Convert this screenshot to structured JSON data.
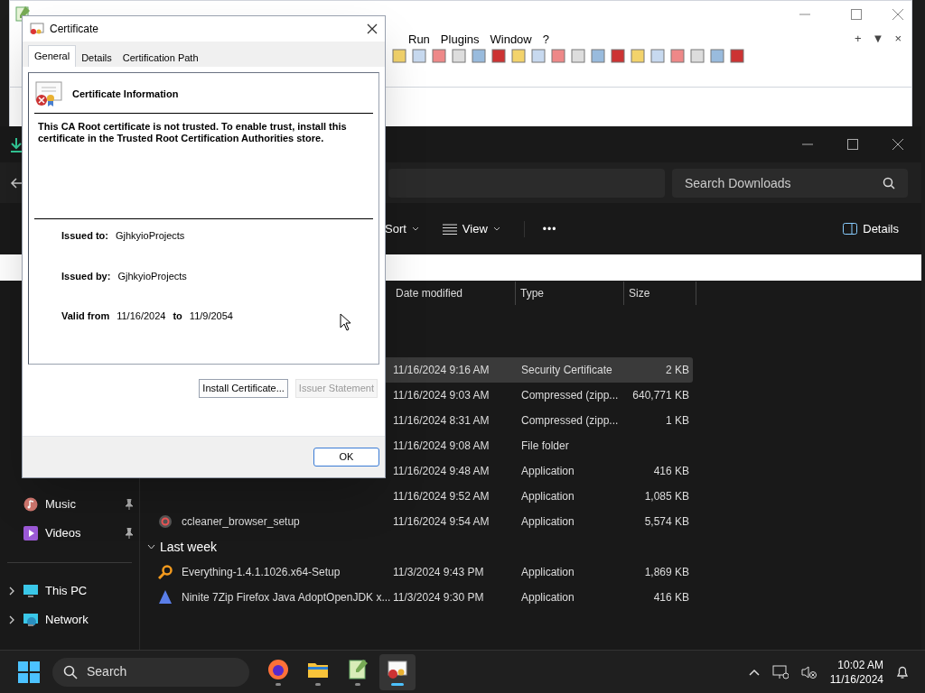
{
  "notepad": {
    "menu": [
      "Run",
      "Plugins",
      "Window",
      "?"
    ],
    "tab_controls": [
      "+",
      "▼",
      "×"
    ]
  },
  "explorer": {
    "search": {
      "placeholder": "Search Downloads"
    },
    "toolbar": [
      {
        "kind": "sort",
        "label": "Sort"
      },
      {
        "kind": "view",
        "label": "View"
      },
      {
        "kind": "more",
        "label": "•••"
      },
      {
        "kind": "details",
        "label": "Details"
      }
    ],
    "columns": [
      "Date modified",
      "Type",
      "Size"
    ],
    "groups": [
      {
        "rows": [
          {
            "date": "11/16/2024 9:16 AM",
            "type": "Security Certificate",
            "size": "2 KB",
            "selected": true
          },
          {
            "date": "11/16/2024 9:03 AM",
            "type": "Compressed (zipp...",
            "size": "640,771 KB",
            "selected": false
          },
          {
            "date": "11/16/2024 8:31 AM",
            "type": "Compressed (zipp...",
            "size": "1 KB",
            "selected": false
          },
          {
            "date": "11/16/2024 9:08 AM",
            "type": "File folder",
            "selected": false
          },
          {
            "date": "11/16/2024 9:48 AM",
            "type": "Application",
            "size": "416 KB",
            "selected": false
          },
          {
            "date": "11/16/2024 9:52 AM",
            "type": "Application",
            "size": "1,085 KB",
            "selected": false
          },
          {
            "name": "ccleaner_browser_setup",
            "kind": "ccleaner",
            "date": "11/16/2024 9:54 AM",
            "type": "Application",
            "size": "5,574 KB",
            "selected": false
          }
        ]
      },
      {
        "title": "Last week",
        "rows": [
          {
            "name": "Everything-1.4.1.1026.x64-Setup",
            "kind": "everything",
            "date": "11/3/2024 9:43 PM",
            "type": "Application",
            "size": "1,869 KB",
            "selected": false
          },
          {
            "name": "Ninite 7Zip Firefox Java AdoptOpenJDK x...",
            "kind": "ninite",
            "date": "11/3/2024 9:30 PM",
            "type": "Application",
            "size": "416 KB",
            "selected": false
          }
        ]
      }
    ],
    "sidebar": [
      {
        "kind": "music",
        "label": "Music",
        "pinned": true
      },
      {
        "kind": "videos",
        "label": "Videos",
        "pinned": true
      },
      {
        "kind": "divider"
      },
      {
        "kind": "pc",
        "label": "This PC",
        "expandable": true
      },
      {
        "kind": "network",
        "label": "Network",
        "expandable": true
      }
    ]
  },
  "dialog": {
    "title": "Certificate",
    "tabs": [
      {
        "label": "General",
        "selected": true
      },
      {
        "label": "Details",
        "selected": false
      },
      {
        "label": "Certification Path",
        "selected": false
      }
    ],
    "heading": "Certificate Information",
    "message": "This CA Root certificate is not trusted. To enable trust, install this certificate in the Trusted Root Certification Authorities store.",
    "issued_to_label": "Issued to:",
    "issued_to": "GjhkyioProjects",
    "issued_by_label": "Issued by:",
    "issued_by": "GjhkyioProjects",
    "valid_from_label": "Valid from",
    "valid_from": "11/16/2024",
    "valid_to_label": "to",
    "valid_to": "11/9/2054",
    "buttons": [
      {
        "label": "Install Certificate...",
        "disabled": false
      },
      {
        "label": "Issuer Statement",
        "disabled": true
      }
    ],
    "ok": "OK"
  },
  "taskbar": {
    "search": "Search",
    "apps": [
      {
        "kind": "firefox",
        "active": false
      },
      {
        "kind": "folder",
        "active": false
      },
      {
        "kind": "notepad",
        "active": false
      },
      {
        "kind": "certificate",
        "active": true
      }
    ],
    "time": "10:02 AM",
    "date": "11/16/2024"
  }
}
